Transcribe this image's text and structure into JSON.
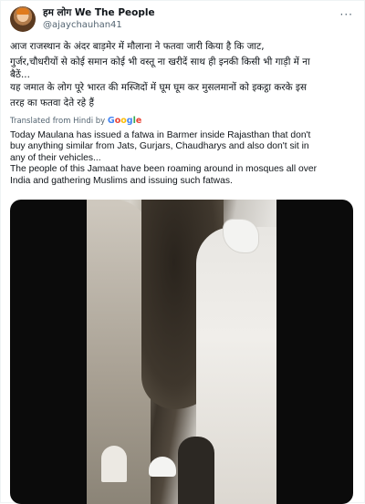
{
  "author": {
    "display_name": "हम लोग We The People",
    "handle": "@ajaychauhan41",
    "avatar_icon": "avatar-icon",
    "more_icon": "more-options-icon"
  },
  "tweet": {
    "hindi_lines": [
      "आज  राजस्थान के अंदर बाड़मेर में मौलाना ने फतवा जारी किया है कि जाट,",
      "गुर्जर,चौधरीयों से कोई समान कोई भी वस्तू ना खरीदें साथ ही इनकी किसी भी गाड़ी में ना",
      "बैठें...",
      " यह जमात के लोग पूरे भारत की मस्जिदों में घूम घूम कर मुसलमानों को इकट्ठा करके इस",
      "तरह का फतवा देते रहे हैं"
    ],
    "translated_label": "Translated from Hindi by",
    "google_letters": [
      "G",
      "o",
      "o",
      "g",
      "l",
      "e"
    ],
    "english_lines": [
      "Today Maulana has issued a fatwa in Barmer inside Rajasthan that don't",
      "buy anything similar from Jats, Gurjars, Chaudharys and also don't sit in",
      "any of their vehicles...",
      "The people of this Jamaat have been roaming around in mosques all over",
      "India and gathering Muslims and issuing such fatwas."
    ]
  },
  "media": {
    "type": "video-still"
  },
  "colors": {
    "text": "#0f1419",
    "muted": "#536471",
    "google_blue": "#4285f4",
    "google_red": "#ea4335",
    "google_yellow": "#fbbc05",
    "google_green": "#34a853"
  }
}
